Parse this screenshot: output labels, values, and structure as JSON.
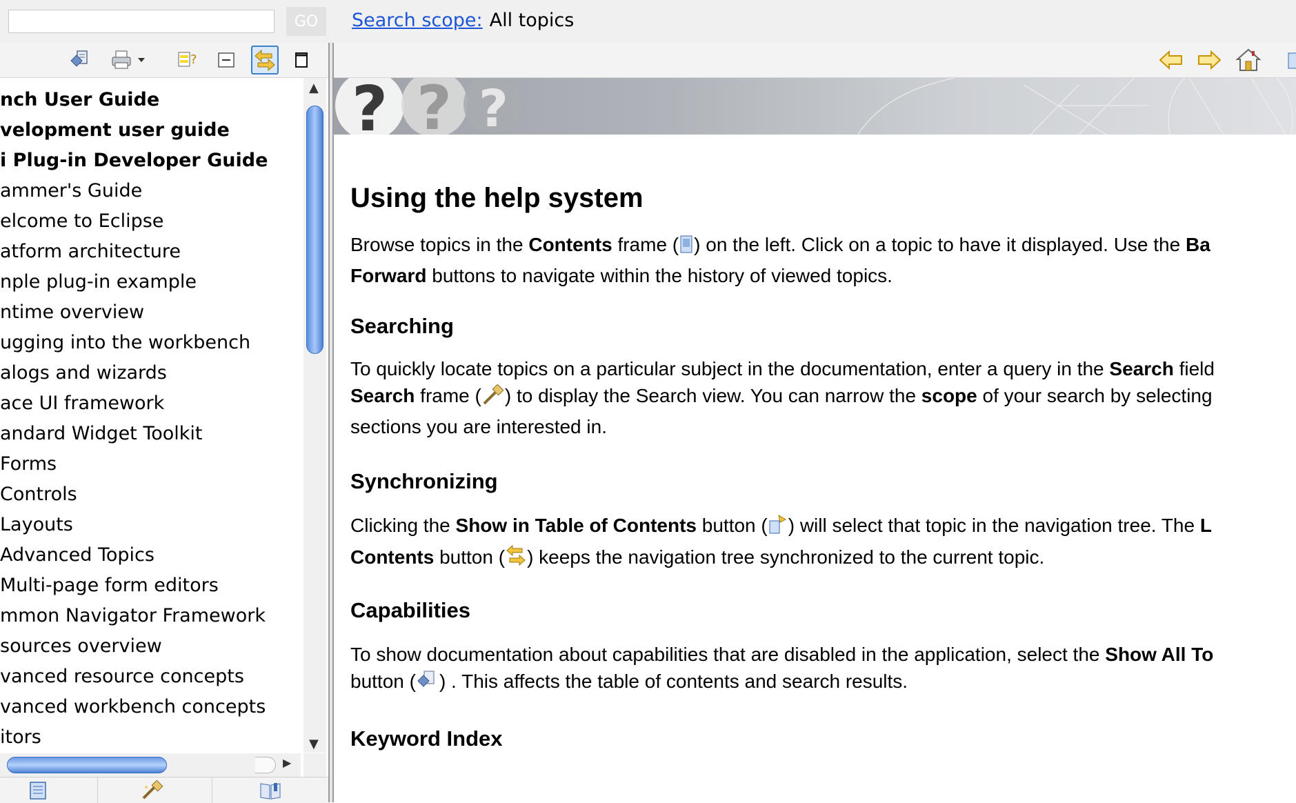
{
  "search": {
    "query": "",
    "go_label": "GO",
    "scope_link": "Search scope:",
    "scope_value": "All topics"
  },
  "toc": {
    "items": [
      {
        "label": "nch User Guide",
        "bold": true
      },
      {
        "label": "velopment user guide",
        "bold": true
      },
      {
        "label": "i Plug-in Developer Guide",
        "bold": true
      },
      {
        "label": "ammer's Guide",
        "bold": false
      },
      {
        "label": "elcome to Eclipse",
        "bold": false
      },
      {
        "label": "atform architecture",
        "bold": false
      },
      {
        "label": "nple plug-in example",
        "bold": false
      },
      {
        "label": "ntime overview",
        "bold": false
      },
      {
        "label": "ugging into the workbench",
        "bold": false
      },
      {
        "label": "alogs and wizards",
        "bold": false
      },
      {
        "label": "ace UI framework",
        "bold": false
      },
      {
        "label": "andard Widget Toolkit",
        "bold": false
      },
      {
        "label": "Forms",
        "bold": false
      },
      {
        "label": "Controls",
        "bold": false
      },
      {
        "label": "Layouts",
        "bold": false
      },
      {
        "label": "Advanced Topics",
        "bold": false
      },
      {
        "label": "Multi-page form editors",
        "bold": false
      },
      {
        "label": "mmon Navigator Framework",
        "bold": false
      },
      {
        "label": "sources overview",
        "bold": false
      },
      {
        "label": "vanced resource concepts",
        "bold": false
      },
      {
        "label": "vanced workbench concepts",
        "bold": false
      },
      {
        "label": "itors",
        "bold": false
      }
    ]
  },
  "icons": {
    "left_toolbar": [
      "show-all-topics-icon",
      "print-icon",
      "highlight-search-icon",
      "collapse-all-icon",
      "link-with-contents-icon",
      "maximize-icon"
    ],
    "right_toolbar": [
      "back-icon",
      "forward-icon",
      "home-icon"
    ],
    "bottom_tabs": [
      "contents-icon",
      "search-icon",
      "bookmarks-icon"
    ]
  },
  "colors": {
    "link": "#1a55d8",
    "scroll_thumb": "#5a8de0",
    "nav_arrow": "#f5b400"
  },
  "content": {
    "title": "Using the help system",
    "intro": {
      "t1": "Browse topics in the ",
      "b1": "Contents",
      "t2": " frame (",
      "t3": ") on the left. Click on a topic to have it displayed. Use the ",
      "b2": "Ba",
      "b3": "Forward",
      "t4": " buttons to navigate within the history of viewed topics."
    },
    "searching": {
      "heading": "Searching",
      "t1": "To quickly locate topics on a particular subject in the documentation, enter a query in the ",
      "b1": "Search",
      "t2": " field",
      "b2": "Search",
      "t3": " frame (",
      "t4": ") to display the Search view. You can narrow the ",
      "b3": "scope",
      "t5": " of your search by selecting",
      "t6": "sections you are interested in."
    },
    "synchronizing": {
      "heading": "Synchronizing",
      "t1": "Clicking the ",
      "b1": "Show in Table of Contents",
      "t2": " button (",
      "t3": ") will select that topic in the navigation tree. The ",
      "b2": "L",
      "b3": "Contents",
      "t4": " button (",
      "t5": ") keeps the navigation tree synchronized to the current topic."
    },
    "capabilities": {
      "heading": "Capabilities",
      "t1": "To show documentation about capabilities that are disabled in the application, select the ",
      "b1": "Show All To",
      "t2": "button (",
      "t3": ") . This affects the table of contents and search results."
    },
    "keyword_heading": "Keyword Index"
  }
}
